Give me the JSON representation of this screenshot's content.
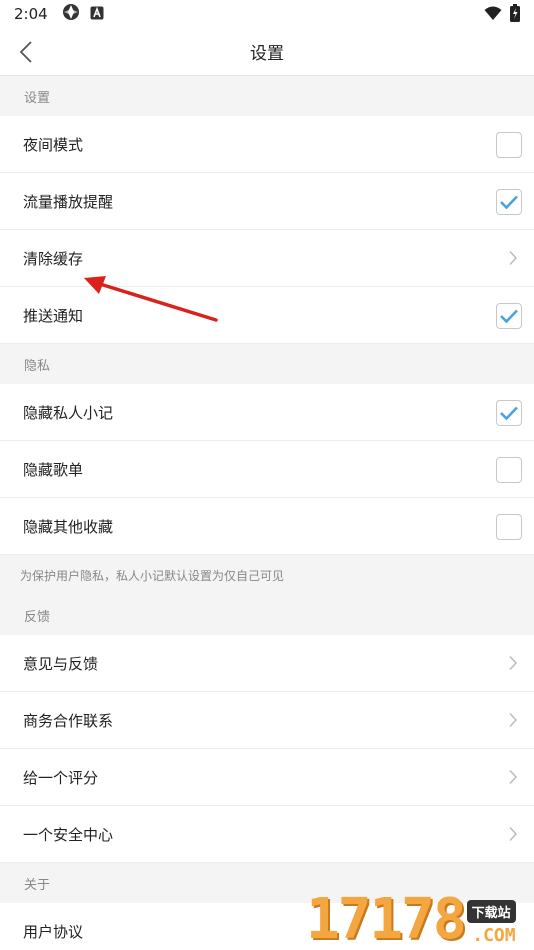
{
  "status_bar": {
    "time": "2:04"
  },
  "header": {
    "title": "设置"
  },
  "sections": {
    "settings": {
      "title": "设置",
      "rows": [
        {
          "label": "夜间模式",
          "control": "checkbox",
          "checked": false
        },
        {
          "label": "流量播放提醒",
          "control": "checkbox",
          "checked": true
        },
        {
          "label": "清除缓存",
          "control": "chevron"
        },
        {
          "label": "推送通知",
          "control": "checkbox",
          "checked": true
        }
      ]
    },
    "privacy": {
      "title": "隐私",
      "rows": [
        {
          "label": "隐藏私人小记",
          "control": "checkbox",
          "checked": true
        },
        {
          "label": "隐藏歌单",
          "control": "checkbox",
          "checked": false
        },
        {
          "label": "隐藏其他收藏",
          "control": "checkbox",
          "checked": false
        }
      ],
      "note": "为保护用户隐私，私人小记默认设置为仅自己可见"
    },
    "feedback": {
      "title": "反馈",
      "rows": [
        {
          "label": "意见与反馈",
          "control": "chevron"
        },
        {
          "label": "商务合作联系",
          "control": "chevron"
        },
        {
          "label": "给一个评分",
          "control": "chevron"
        },
        {
          "label": "一个安全中心",
          "control": "chevron"
        }
      ]
    },
    "about": {
      "title": "关于",
      "rows": [
        {
          "label": "用户协议",
          "control": "chevron"
        }
      ]
    }
  },
  "watermark": {
    "digits": "17178",
    "badge": "下载站",
    "domain": ".COM"
  },
  "colors": {
    "accent": "#4aa3df",
    "annotation": "#d9221c",
    "divider": "#ececec"
  }
}
